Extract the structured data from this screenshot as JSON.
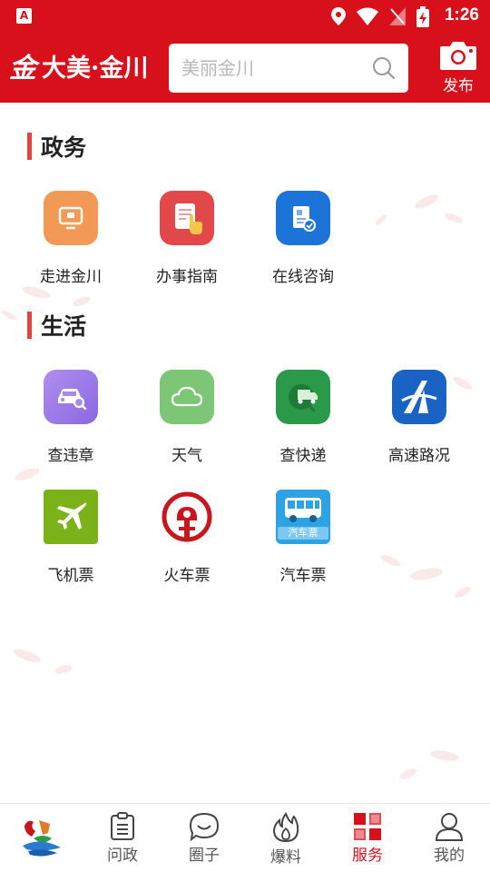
{
  "status_bar": {
    "time": "1:26",
    "app_badge": "A"
  },
  "header": {
    "logo_text": "大美·金川",
    "logo_glyph": "金",
    "search_placeholder": "美丽金川",
    "publish_label": "发布"
  },
  "sections": [
    {
      "title": "政务",
      "items": [
        {
          "label": "走进金川",
          "icon": "monitor-icon",
          "color": "#f29a55"
        },
        {
          "label": "办事指南",
          "icon": "guide-hand-icon",
          "color": "#e2474a"
        },
        {
          "label": "在线咨询",
          "icon": "consult-doc-icon",
          "color": "#1d74d8"
        }
      ]
    },
    {
      "title": "生活",
      "items": [
        {
          "label": "查违章",
          "icon": "car-search-icon",
          "color": "#9a7ae8"
        },
        {
          "label": "天气",
          "icon": "cloud-icon",
          "color": "#7cc676"
        },
        {
          "label": "查快递",
          "icon": "delivery-truck-icon",
          "color": "#2a9a4a"
        },
        {
          "label": "高速路况",
          "icon": "highway-icon",
          "color": "#1a62c4"
        },
        {
          "label": "飞机票",
          "icon": "airplane-icon",
          "color": "#7bb21a"
        },
        {
          "label": "火车票",
          "icon": "railway-icon",
          "color": "#c8161d"
        },
        {
          "label": "汽车票",
          "icon": "bus-icon",
          "color": "#2fa2e4",
          "sub": "汽车票"
        }
      ]
    }
  ],
  "tabbar": {
    "tabs": [
      {
        "label": "",
        "icon": "home-logo-icon"
      },
      {
        "label": "问政",
        "icon": "clipboard-icon"
      },
      {
        "label": "圈子",
        "icon": "smile-bubble-icon"
      },
      {
        "label": "爆料",
        "icon": "flame-icon"
      },
      {
        "label": "服务",
        "icon": "grid-icon",
        "active": true
      },
      {
        "label": "我的",
        "icon": "person-icon"
      }
    ]
  },
  "colors": {
    "brand_red": "#d8101c",
    "section_accent": "#e8403c"
  }
}
